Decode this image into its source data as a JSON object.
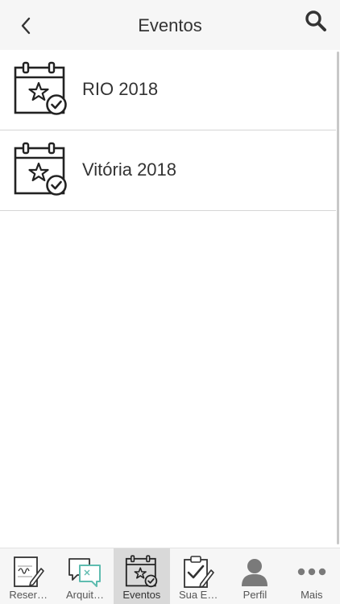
{
  "nav": {
    "title": "Eventos",
    "back_icon": "chevron-left-icon",
    "search_icon": "search-icon"
  },
  "events": [
    {
      "label": "RIO 2018",
      "icon": "calendar-star-check-icon"
    },
    {
      "label": "Vitória 2018",
      "icon": "calendar-star-check-icon"
    }
  ],
  "tabs": [
    {
      "label": "Reser…",
      "icon": "document-sign-icon",
      "active": false
    },
    {
      "label": "Arquit…",
      "icon": "chat-bubbles-icon",
      "active": false
    },
    {
      "label": "Eventos",
      "icon": "calendar-star-check-icon",
      "active": true
    },
    {
      "label": "Sua E…",
      "icon": "clipboard-pencil-icon",
      "active": false
    },
    {
      "label": "Perfil",
      "icon": "user-icon",
      "active": false
    },
    {
      "label": "Mais",
      "icon": "more-dots-icon",
      "active": false
    }
  ],
  "colors": {
    "bar_background": "#f6f6f6",
    "active_tab": "#d9d9d9",
    "chat_accent": "#5fbcb0",
    "text": "#333333"
  }
}
